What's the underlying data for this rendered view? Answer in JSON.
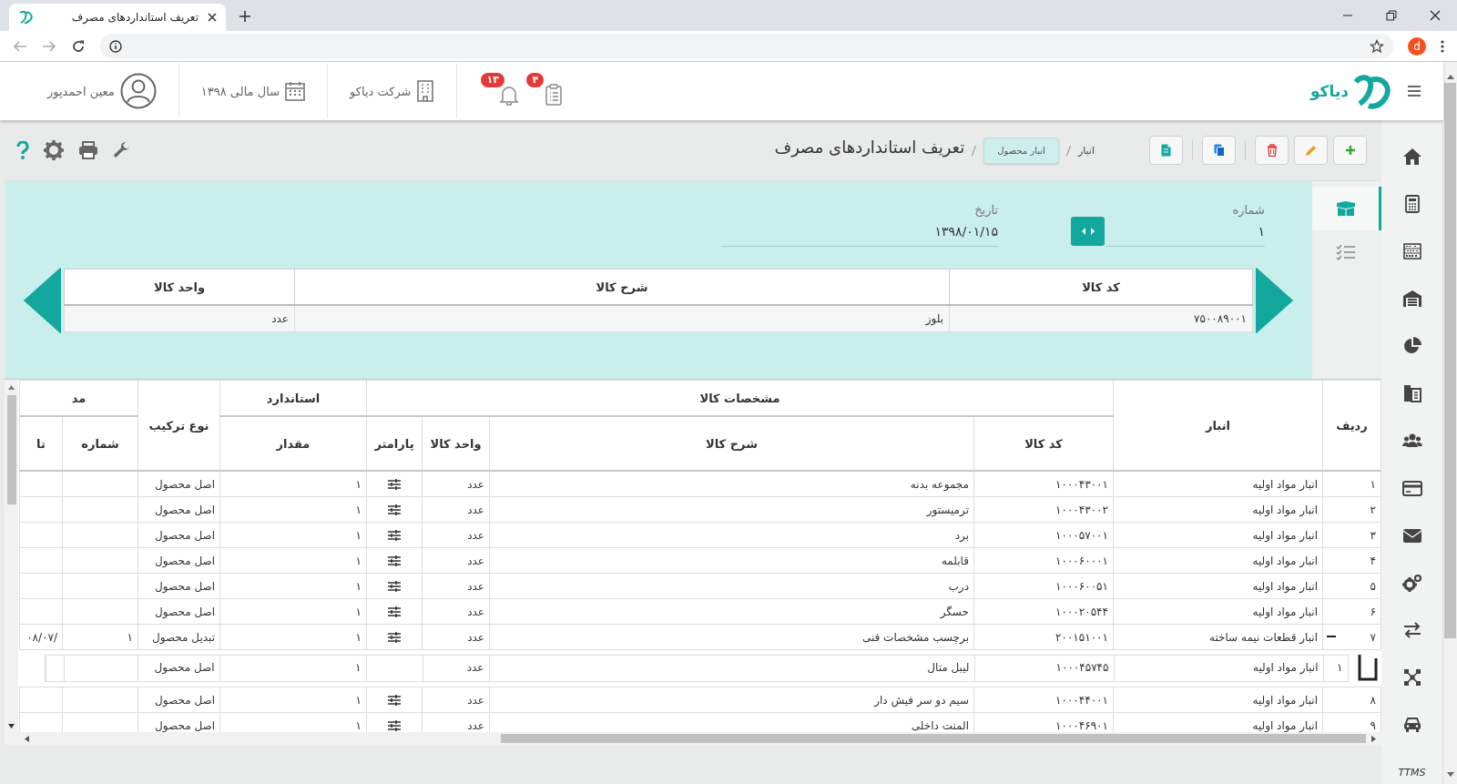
{
  "browser": {
    "tab_title": "تعریف استانداردهای مصرف",
    "avatar_letter": "d"
  },
  "header": {
    "logo_text": "دیاکو",
    "tasks_badge": "۴",
    "notifications_badge": "۱۳",
    "company": "شرکت دیاکو",
    "fiscal_year": "سال مالی ۱۳۹۸",
    "user": "معین احمدپور"
  },
  "toolbar": {
    "breadcrumb": [
      {
        "label": "انبار",
        "kind": "link"
      },
      {
        "label": "انبار محصول",
        "kind": "chip"
      }
    ],
    "page_title": "تعریف استانداردهای مصرف"
  },
  "form": {
    "tabs": [
      {
        "selected": true
      },
      {
        "selected": false
      }
    ],
    "fields": [
      {
        "label": "شماره",
        "value": "۱"
      },
      {
        "label": "تاریخ",
        "value": "۱۳۹۸/۰۱/۱۵"
      }
    ],
    "product": {
      "columns": [
        "کد کالا",
        "شرح کالا",
        "واحد کالا"
      ],
      "values": [
        "۷۵۰۰۸۹۰۰۱",
        "بلوز",
        "عدد"
      ]
    }
  },
  "table": {
    "columns": [
      {
        "label": "ردیف"
      },
      {
        "label": "انبار"
      },
      {
        "label": "مشخصات کالا",
        "children": [
          {
            "label": "کد کالا"
          },
          {
            "label": "شرح کالا"
          },
          {
            "label": "واحد کالا"
          },
          {
            "label": "پارامتر"
          }
        ]
      },
      {
        "label": "استاندارد",
        "children": [
          {
            "label": "مقدار"
          }
        ]
      },
      {
        "label": "نوع ترکیب"
      },
      {
        "label": "مد",
        "children": [
          {
            "label": "شماره"
          },
          {
            "label": "تا"
          }
        ]
      }
    ],
    "rows": [
      {
        "row_no": "۱",
        "warehouse": "انبار مواد اولیه",
        "item_code": "۱۰۰۰۴۳۰۰۱",
        "item_description": "مجموعه بدنه",
        "unit": "عدد",
        "quantity": "۱",
        "combination_type": "اصل محصول"
      },
      {
        "row_no": "۲",
        "warehouse": "انبار مواد اولیه",
        "item_code": "۱۰۰۰۴۳۰۰۲",
        "item_description": "ترمیستور",
        "unit": "عدد",
        "quantity": "۱",
        "combination_type": "اصل محصول"
      },
      {
        "row_no": "۳",
        "warehouse": "انبار مواد اولیه",
        "item_code": "۱۰۰۰۵۷۰۰۱",
        "item_description": "برد",
        "unit": "عدد",
        "quantity": "۱",
        "combination_type": "اصل محصول"
      },
      {
        "row_no": "۴",
        "warehouse": "انبار مواد اولیه",
        "item_code": "۱۰۰۰۶۰۰۰۱",
        "item_description": "قابلمه",
        "unit": "عدد",
        "quantity": "۱",
        "combination_type": "اصل محصول"
      },
      {
        "row_no": "۵",
        "warehouse": "انبار مواد اولیه",
        "item_code": "۱۰۰۰۶۰۰۵۱",
        "item_description": "درب",
        "unit": "عدد",
        "quantity": "۱",
        "combination_type": "اصل محصول"
      },
      {
        "row_no": "۶",
        "warehouse": "انبار مواد اولیه",
        "item_code": "۱۰۰۰۲۰۵۴۴",
        "item_description": "حسگر",
        "unit": "عدد",
        "quantity": "۱",
        "combination_type": "اصل محصول"
      },
      {
        "row_no": "۷",
        "warehouse": "انبار قطعات نیمه ساخته",
        "item_code": "۲۰۰۱۵۱۰۰۱",
        "item_description": "برچسب مشخصات فنی",
        "unit": "عدد",
        "quantity": "۱",
        "combination_type": "تبدیل محصول",
        "number": "۱",
        "column_10": "/۰۸/۰۷",
        "expanded": true,
        "children": [
          {
            "row_no": "۱",
            "warehouse": "انبار مواد اولیه",
            "item_code": "۱۰۰۰۴۵۷۴۵",
            "item_description": "لیبل متال",
            "unit": "عدد",
            "quantity": "۱",
            "combination_type": "اصل محصول"
          }
        ]
      },
      {
        "row_no": "۸",
        "warehouse": "انبار مواد اولیه",
        "item_code": "۱۰۰۰۴۴۰۰۱",
        "item_description": "سیم دو سر فیش دار",
        "unit": "عدد",
        "quantity": "۱",
        "combination_type": "اصل محصول"
      },
      {
        "row_no": "۹",
        "warehouse": "انبار مواد اولیه",
        "item_code": "۱۰۰۰۴۶۹۰۱",
        "item_description": "المنت داخلی",
        "unit": "عدد",
        "quantity": "۱",
        "combination_type": "اصل محصول"
      }
    ]
  },
  "sidebar": {
    "footer": "TTMS"
  }
}
